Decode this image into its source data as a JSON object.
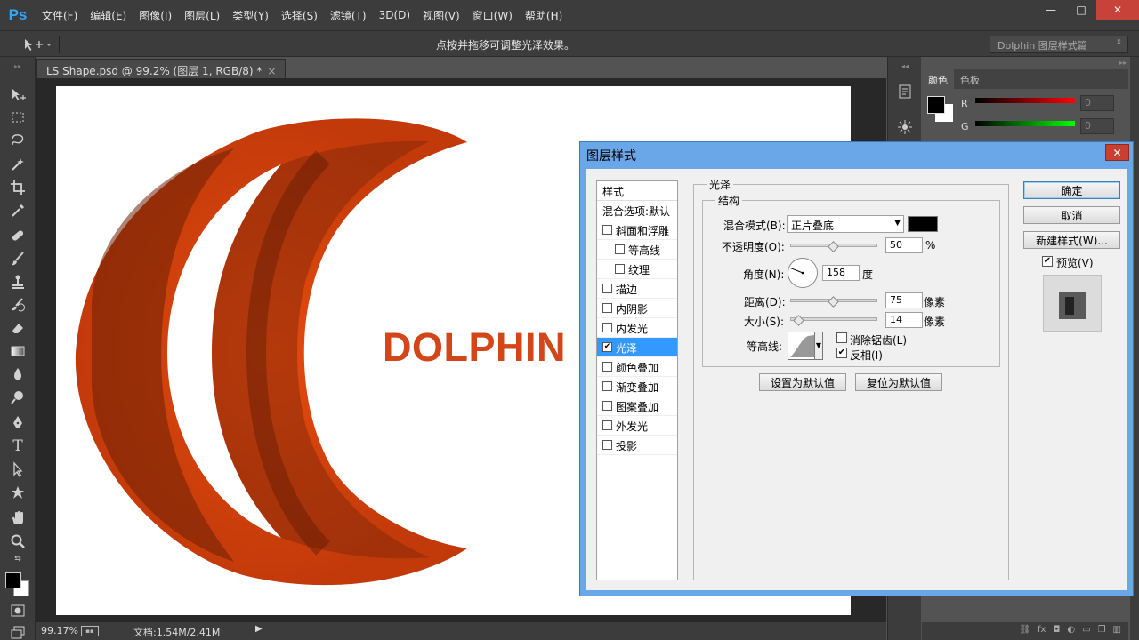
{
  "app": {
    "logo": "Ps"
  },
  "menu": [
    "文件(F)",
    "编辑(E)",
    "图像(I)",
    "图层(L)",
    "类型(Y)",
    "选择(S)",
    "滤镜(T)",
    "3D(D)",
    "视图(V)",
    "窗口(W)",
    "帮助(H)"
  ],
  "window_controls": {
    "minimize": "—",
    "restore": "□",
    "close": "✕"
  },
  "options_bar": {
    "hint": "点按并拖移可调整光泽效果。",
    "workspace": "Dolphin 图层样式篇"
  },
  "document": {
    "tab_title": "LS Shape.psd @ 99.2% (图层 1, RGB/8) *",
    "tab_close": "×",
    "canvas_text": "DOLPHIN",
    "shape_color": "#e34a0e"
  },
  "status_bar": {
    "zoom": "99.17%",
    "doc_size": "文档:1.54M/2.41M"
  },
  "color_panel": {
    "tabs": [
      "颜色",
      "色板"
    ],
    "sliders": [
      {
        "label": "R",
        "value": "0"
      },
      {
        "label": "G",
        "value": "0"
      }
    ]
  },
  "dialog": {
    "title": "图层样式",
    "close": "✕",
    "styles_header": "样式",
    "blend_options": "混合选项:默认",
    "style_items": [
      {
        "label": "斜面和浮雕",
        "checked": false,
        "indent": false,
        "selected": false
      },
      {
        "label": "等高线",
        "checked": false,
        "indent": true,
        "selected": false
      },
      {
        "label": "纹理",
        "checked": false,
        "indent": true,
        "selected": false
      },
      {
        "label": "描边",
        "checked": false,
        "indent": false,
        "selected": false
      },
      {
        "label": "内阴影",
        "checked": false,
        "indent": false,
        "selected": false
      },
      {
        "label": "内发光",
        "checked": false,
        "indent": false,
        "selected": false
      },
      {
        "label": "光泽",
        "checked": true,
        "indent": false,
        "selected": true
      },
      {
        "label": "颜色叠加",
        "checked": false,
        "indent": false,
        "selected": false
      },
      {
        "label": "渐变叠加",
        "checked": false,
        "indent": false,
        "selected": false
      },
      {
        "label": "图案叠加",
        "checked": false,
        "indent": false,
        "selected": false
      },
      {
        "label": "外发光",
        "checked": false,
        "indent": false,
        "selected": false
      },
      {
        "label": "投影",
        "checked": false,
        "indent": false,
        "selected": false
      }
    ],
    "section_title": "光泽",
    "group_title": "结构",
    "blend_mode": {
      "label": "混合模式(B):",
      "value": "正片叠底",
      "color": "#000000"
    },
    "opacity": {
      "label": "不透明度(O):",
      "value": "50",
      "unit": "%",
      "level": 50
    },
    "angle": {
      "label": "角度(N):",
      "value": "158",
      "unit": "度"
    },
    "distance": {
      "label": "距离(D):",
      "value": "75",
      "unit": "像素",
      "level": 0.5
    },
    "size": {
      "label": "大小(S):",
      "value": "14",
      "unit": "像素",
      "level": 0.1
    },
    "contour": {
      "label": "等高线:",
      "anti_alias": "消除锯齿(L)",
      "anti_alias_checked": false,
      "invert": "反相(I)",
      "invert_checked": true
    },
    "make_default": "设置为默认值",
    "reset_default": "复位为默认值",
    "ok": "确定",
    "cancel": "取消",
    "new_style": "新建样式(W)...",
    "preview": {
      "label": "预览(V)",
      "checked": true
    }
  }
}
